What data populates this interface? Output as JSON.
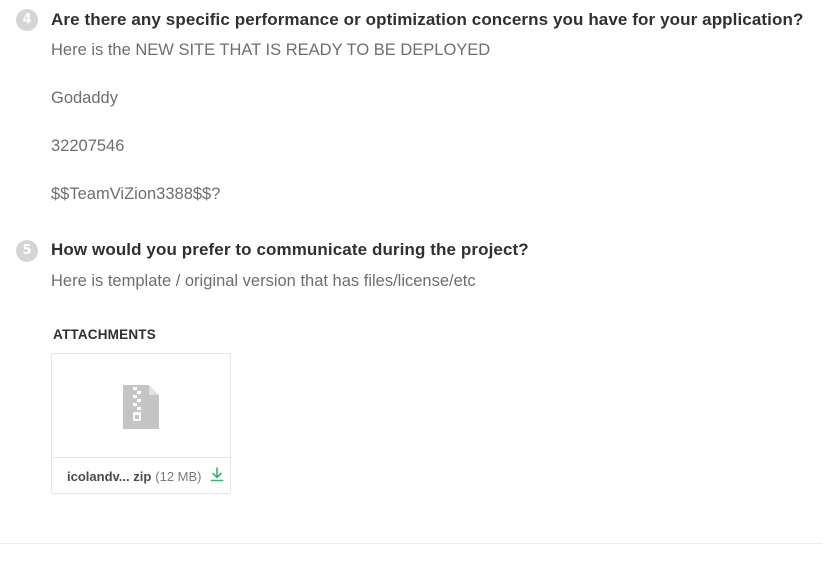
{
  "questions": [
    {
      "number": "4",
      "text": "Are there any specific performance or optimization concerns you have for your application?",
      "answers": [
        "Here is the NEW SITE THAT IS READY TO BE DEPLOYED",
        "Godaddy",
        "32207546",
        "$$TeamViZion3388$$?"
      ]
    },
    {
      "number": "5",
      "text": "How would you prefer to communicate during the project?",
      "answers": [
        "Here is template / original version that has files/license/etc"
      ]
    }
  ],
  "attachments": {
    "title": "ATTACHMENTS",
    "files": [
      {
        "name": "icolandv... zip",
        "size": "(12 MB)",
        "icon": "zip-file-icon",
        "action_icon": "download-icon"
      }
    ]
  },
  "colors": {
    "badge": "#d5d5d5",
    "download": "#3cb371",
    "file_icon": "#c4c4c4"
  }
}
